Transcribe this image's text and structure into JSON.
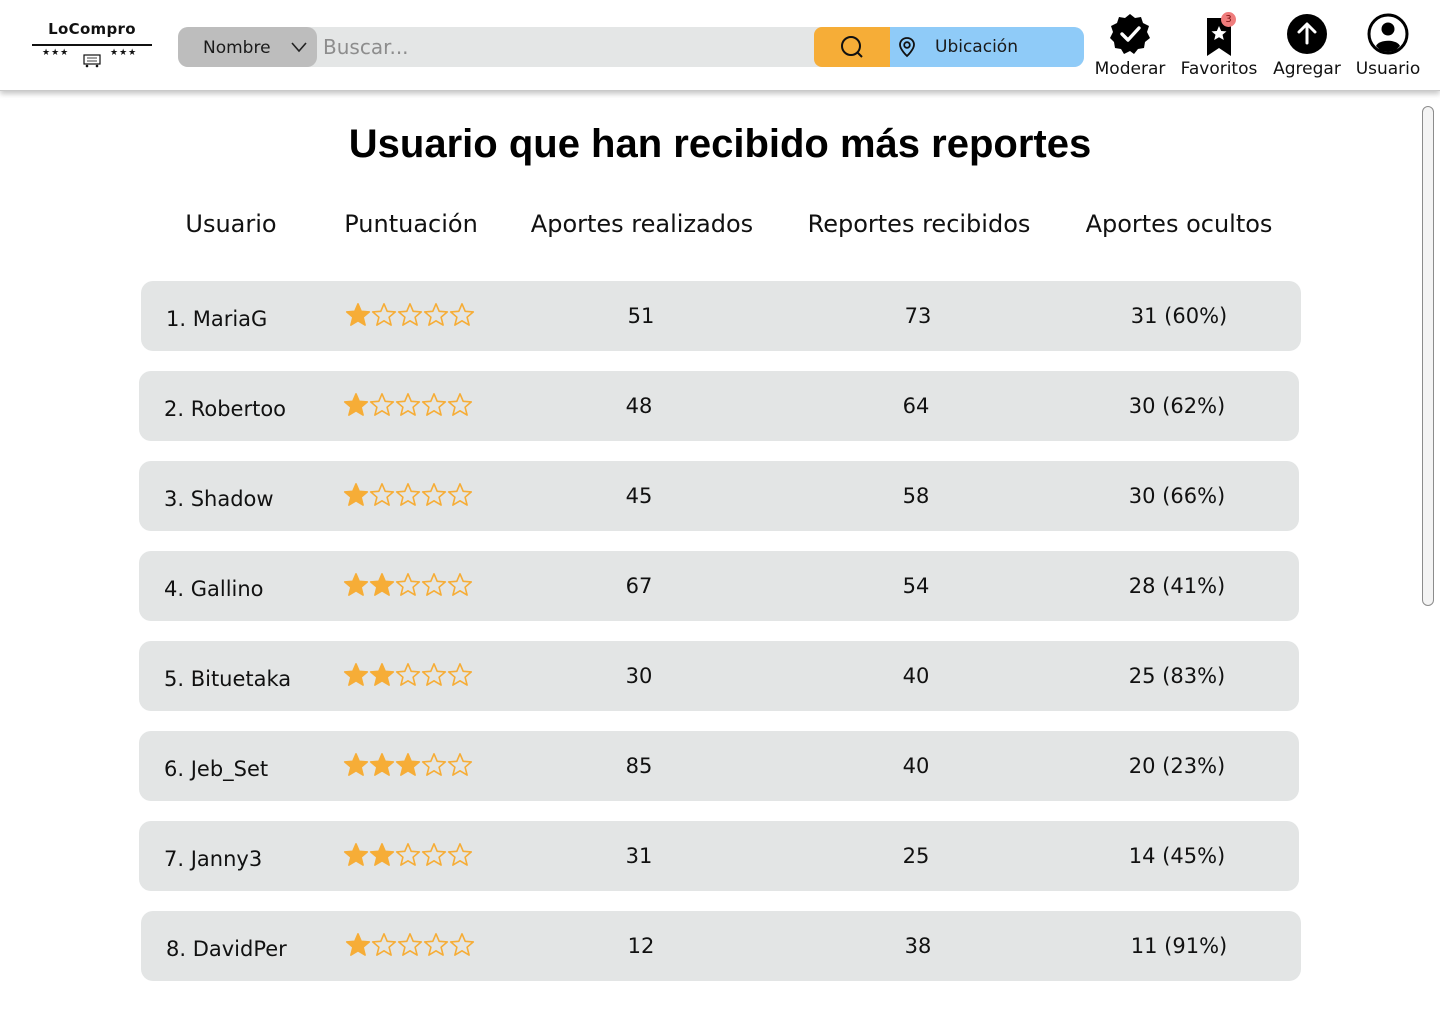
{
  "logo": {
    "title": "LoCompro",
    "stars_left": "★★★",
    "stars_right": "★★★",
    "icon": "shopping-cart-icon"
  },
  "search": {
    "filter_label": "Nombre",
    "placeholder": "Buscar...",
    "search_icon": "search-icon",
    "location_label": "Ubicación",
    "location_icon": "location-pin-icon"
  },
  "nav": {
    "moderate": {
      "label": "Moderar",
      "icon": "verified-check-icon"
    },
    "favorites": {
      "label": "Favoritos",
      "icon": "bookmark-star-icon",
      "badge": "3"
    },
    "add": {
      "label": "Agregar",
      "icon": "upload-arrow-icon"
    },
    "user": {
      "label": "Usuario",
      "icon": "user-circle-icon"
    }
  },
  "colors": {
    "accent_orange": "#f6ad37",
    "location_blue": "#8fcbf8",
    "row_bg": "#e3e5e5",
    "badge": "#ef7c7c"
  },
  "page": {
    "title": "Usuario que han recibido más reportes"
  },
  "table": {
    "headers": {
      "user": "Usuario",
      "rating": "Puntuación",
      "contributions": "Aportes realizados",
      "reports": "Reportes recibidos",
      "hidden": "Aportes ocultos"
    },
    "rows": [
      {
        "user": "1. MariaG",
        "rating": 1,
        "contributions": "51",
        "reports": "73",
        "hidden": "31 (60%)"
      },
      {
        "user": "2. Robertoo",
        "rating": 1,
        "contributions": "48",
        "reports": "64",
        "hidden": "30 (62%)"
      },
      {
        "user": "3. Shadow",
        "rating": 1,
        "contributions": "45",
        "reports": "58",
        "hidden": "30 (66%)"
      },
      {
        "user": "4. Gallino",
        "rating": 2,
        "contributions": "67",
        "reports": "54",
        "hidden": "28 (41%)"
      },
      {
        "user": "5. Bituetaka",
        "rating": 2,
        "contributions": "30",
        "reports": "40",
        "hidden": "25 (83%)"
      },
      {
        "user": "6. Jeb_Set",
        "rating": 3,
        "contributions": "85",
        "reports": "40",
        "hidden": "20 (23%)"
      },
      {
        "user": "7. Janny3",
        "rating": 2,
        "contributions": "31",
        "reports": "25",
        "hidden": "14 (45%)"
      },
      {
        "user": "8. DavidPer",
        "rating": 1,
        "contributions": "12",
        "reports": "38",
        "hidden": "11 (91%)"
      }
    ],
    "max_rating": 5
  }
}
